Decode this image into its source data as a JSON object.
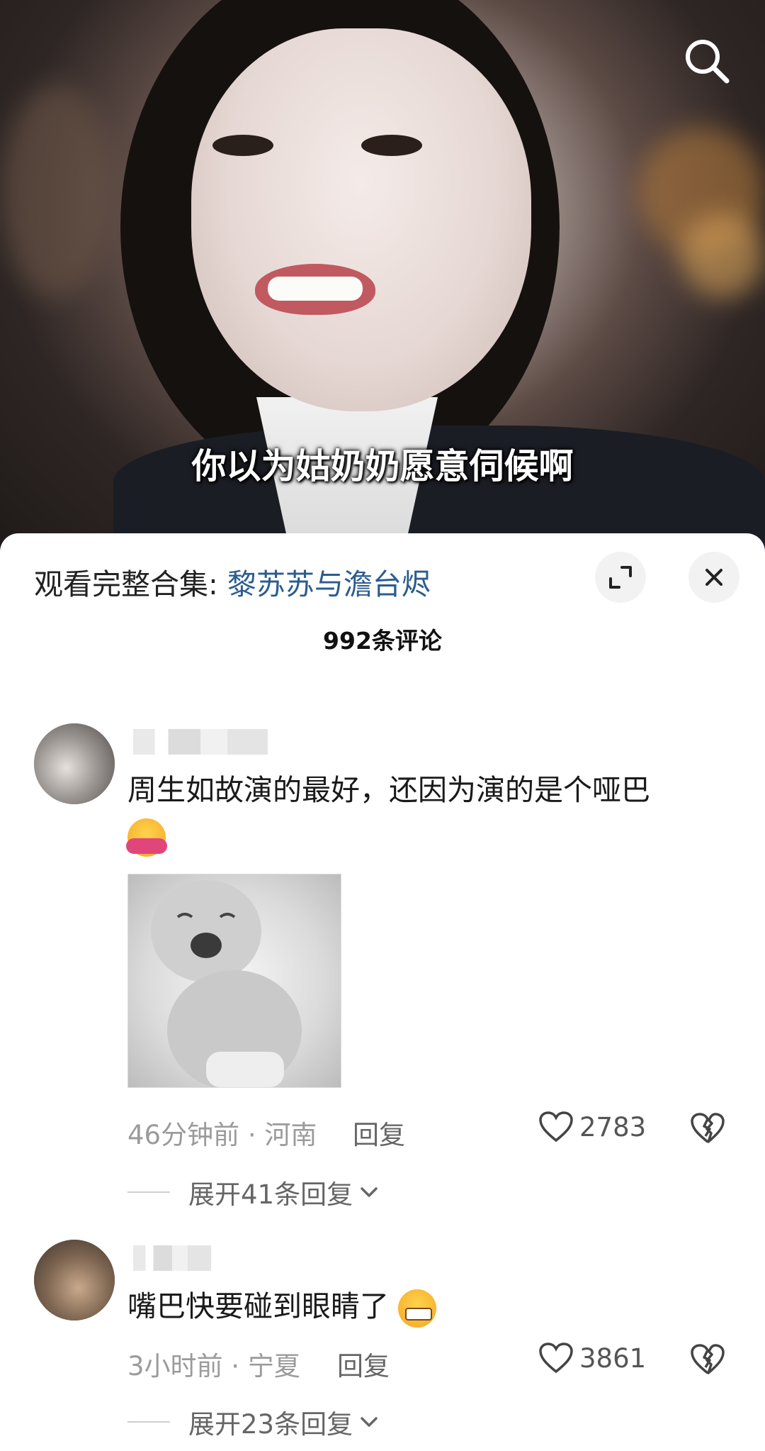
{
  "video": {
    "subtitle": "你以为姑奶奶愿意伺候啊",
    "search_icon": "search-icon"
  },
  "sheet": {
    "collection_prefix": "观看完整合集: ",
    "collection_link": "黎苏苏与澹台烬",
    "expand_icon": "expand-icon",
    "close_icon": "close-icon",
    "comment_count": "992条评论"
  },
  "comments": [
    {
      "text": "周生如故演的最好，还因为演的是个哑巴",
      "emoji": "hugging-face-emoji",
      "has_image": true,
      "meta": "46分钟前 · 河南",
      "reply_label": "回复",
      "likes": "2783",
      "expand_label": "展开41条回复"
    },
    {
      "text": "嘴巴快要碰到眼睛了",
      "emoji": "grinning-face-emoji",
      "has_image": false,
      "meta": "3小时前 · 宁夏",
      "reply_label": "回复",
      "likes": "3861",
      "expand_label": "展开23条回复"
    }
  ],
  "colors": {
    "link": "#2b5c8f",
    "meta": "#9b9b9b",
    "text": "#1a1a1a"
  }
}
